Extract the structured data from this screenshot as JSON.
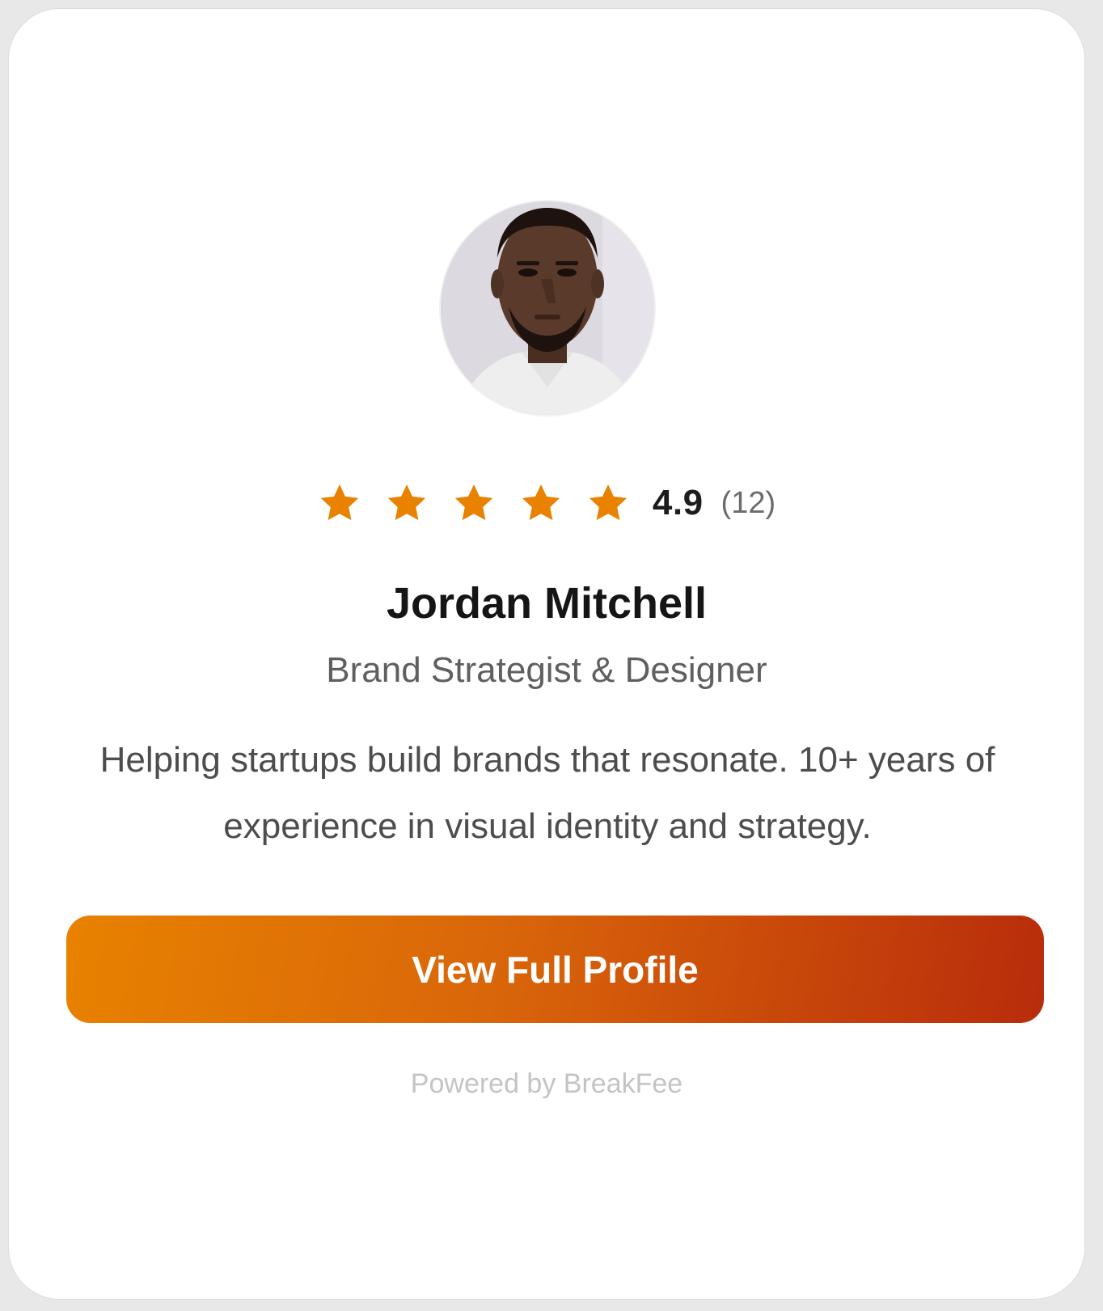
{
  "profile": {
    "avatar_alt": "profile photo",
    "rating": {
      "stars": 5,
      "max_stars": 5,
      "score": "4.9",
      "count": "(12)"
    },
    "name": "Jordan Mitchell",
    "title": "Brand Strategist & Designer",
    "bio": "Helping startups build brands that resonate. 10+ years of experience in visual identity and strategy.",
    "cta_label": "View Full Profile",
    "powered_by": "Powered by BreakFee"
  },
  "colors": {
    "star": "#e88200",
    "cta_start": "#e88200",
    "cta_end": "#b82c0b"
  },
  "icons": {
    "star": "star-icon"
  }
}
